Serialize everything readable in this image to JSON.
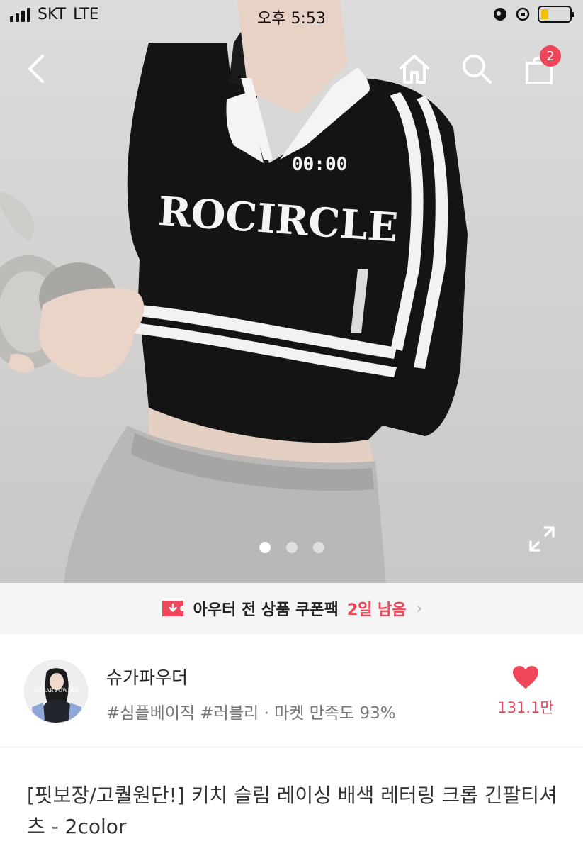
{
  "status_bar": {
    "carrier": "SKT",
    "network": "LTE",
    "time": "오후 5:53",
    "battery_color": "#f2c200"
  },
  "nav": {
    "back_icon": "chevron-left-icon",
    "home_icon": "home-icon",
    "search_icon": "search-icon",
    "cart_icon": "shopping-bag-icon",
    "cart_count": "2"
  },
  "gallery": {
    "image_count": 3,
    "active_index": 0,
    "shirt_text": "ROCIRCLE",
    "shirt_time": "00:00",
    "expand_icon": "expand-icon"
  },
  "coupon": {
    "icon": "coupon-download-icon",
    "text": "아우터 전 상품 쿠폰팩",
    "days_left": "2일 남음",
    "chevron": "›"
  },
  "seller": {
    "avatar_text": "SUGAR POWDER",
    "name": "슈가파우더",
    "tags": "#심플베이직 #러블리 · 마켓 만족도 93%",
    "likes": "131.1만",
    "like_icon": "heart-icon"
  },
  "product": {
    "title": "[핏보장/고퀄원단!] 키치 슬림 레이싱 배색 레터링 크롭 긴팔티셔츠 - 2color"
  },
  "colors": {
    "accent": "#f0465a",
    "banner_bg": "#f5f5f6",
    "secondary_text": "#777777"
  }
}
